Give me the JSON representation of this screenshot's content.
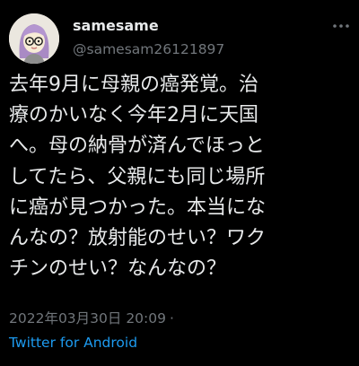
{
  "user": {
    "display_name": "samesame",
    "handle": "@samesam26121897",
    "avatar_icon": "cartoon-avatar-icon"
  },
  "tweet": {
    "lines": [
      "去年9月に母親の癌発覚。治",
      "療のかいなく今年2月に天国",
      "へ。母の納骨が済んでほっと",
      "してたら、父親にも同じ場所",
      "に癌が見つかった。本当にな",
      "んなの？放射能のせい？ワク",
      "チンのせい？なんなの？"
    ],
    "timestamp": "2022年03月30日 20:09",
    "separator": "·",
    "source": "Twitter for Android"
  },
  "menu": {
    "icon": "more-options-icon"
  },
  "colors": {
    "background": "#000000",
    "text": "#e7e9ea",
    "secondary": "#71767b",
    "link": "#1d9bf0"
  }
}
